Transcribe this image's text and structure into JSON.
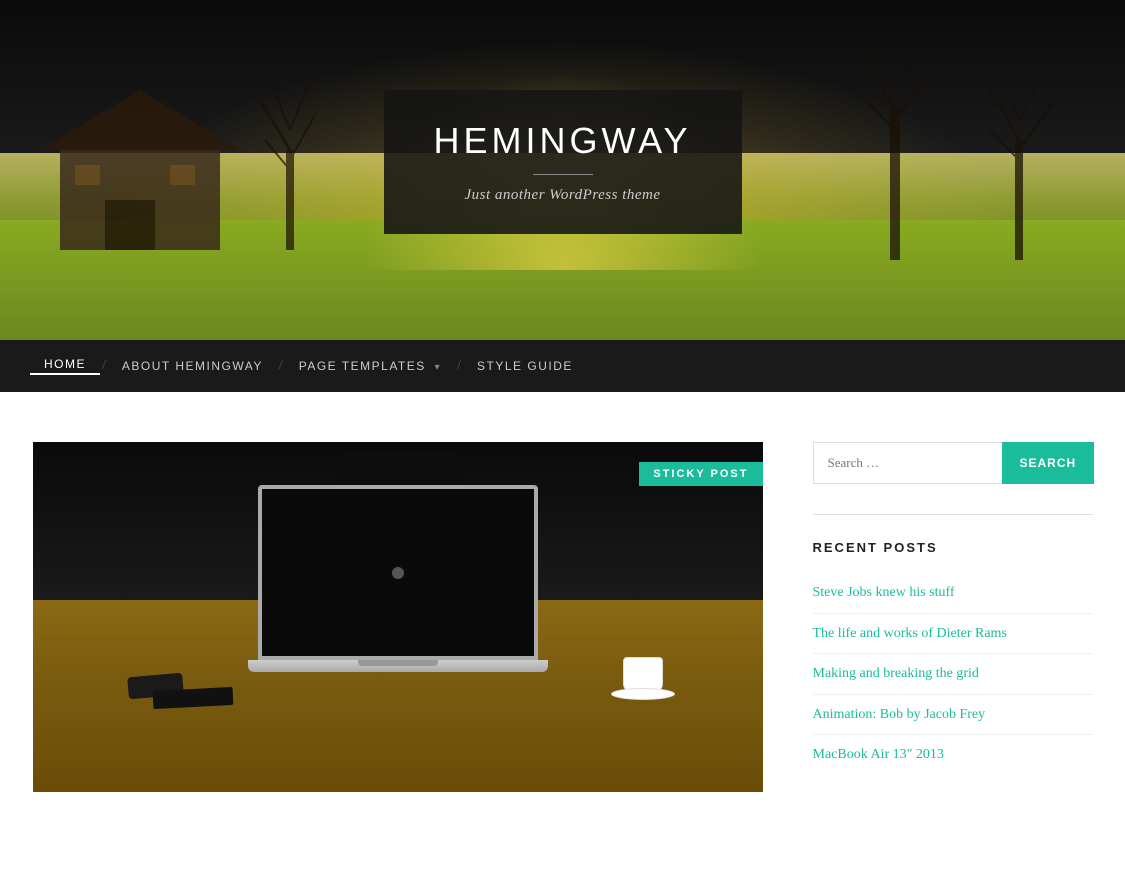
{
  "site": {
    "title_part1": "HEMING",
    "title_part2": "WAY",
    "subtitle": "Just another WordPress theme"
  },
  "nav": {
    "items": [
      {
        "label": "HOME",
        "active": true,
        "href": "#"
      },
      {
        "label": "ABOUT HEMINGWAY",
        "active": false,
        "href": "#"
      },
      {
        "label": "PAGE TEMPLATES",
        "active": false,
        "href": "#",
        "dropdown": true
      },
      {
        "label": "STYLE GUIDE",
        "active": false,
        "href": "#"
      }
    ],
    "separator": "/"
  },
  "post": {
    "sticky_badge": "STICKY POST"
  },
  "sidebar": {
    "search": {
      "placeholder": "Search …",
      "button_label": "SEARCH"
    },
    "recent_posts": {
      "heading": "RECENT POSTS",
      "items": [
        {
          "label": "Steve Jobs knew his stuff",
          "href": "#"
        },
        {
          "label": "The life and works of Dieter Rams",
          "href": "#"
        },
        {
          "label": "Making and breaking the grid",
          "href": "#"
        },
        {
          "label": "Animation: Bob by Jacob Frey",
          "href": "#"
        },
        {
          "label": "MacBook Air 13\" 2013",
          "href": "#"
        }
      ]
    }
  }
}
